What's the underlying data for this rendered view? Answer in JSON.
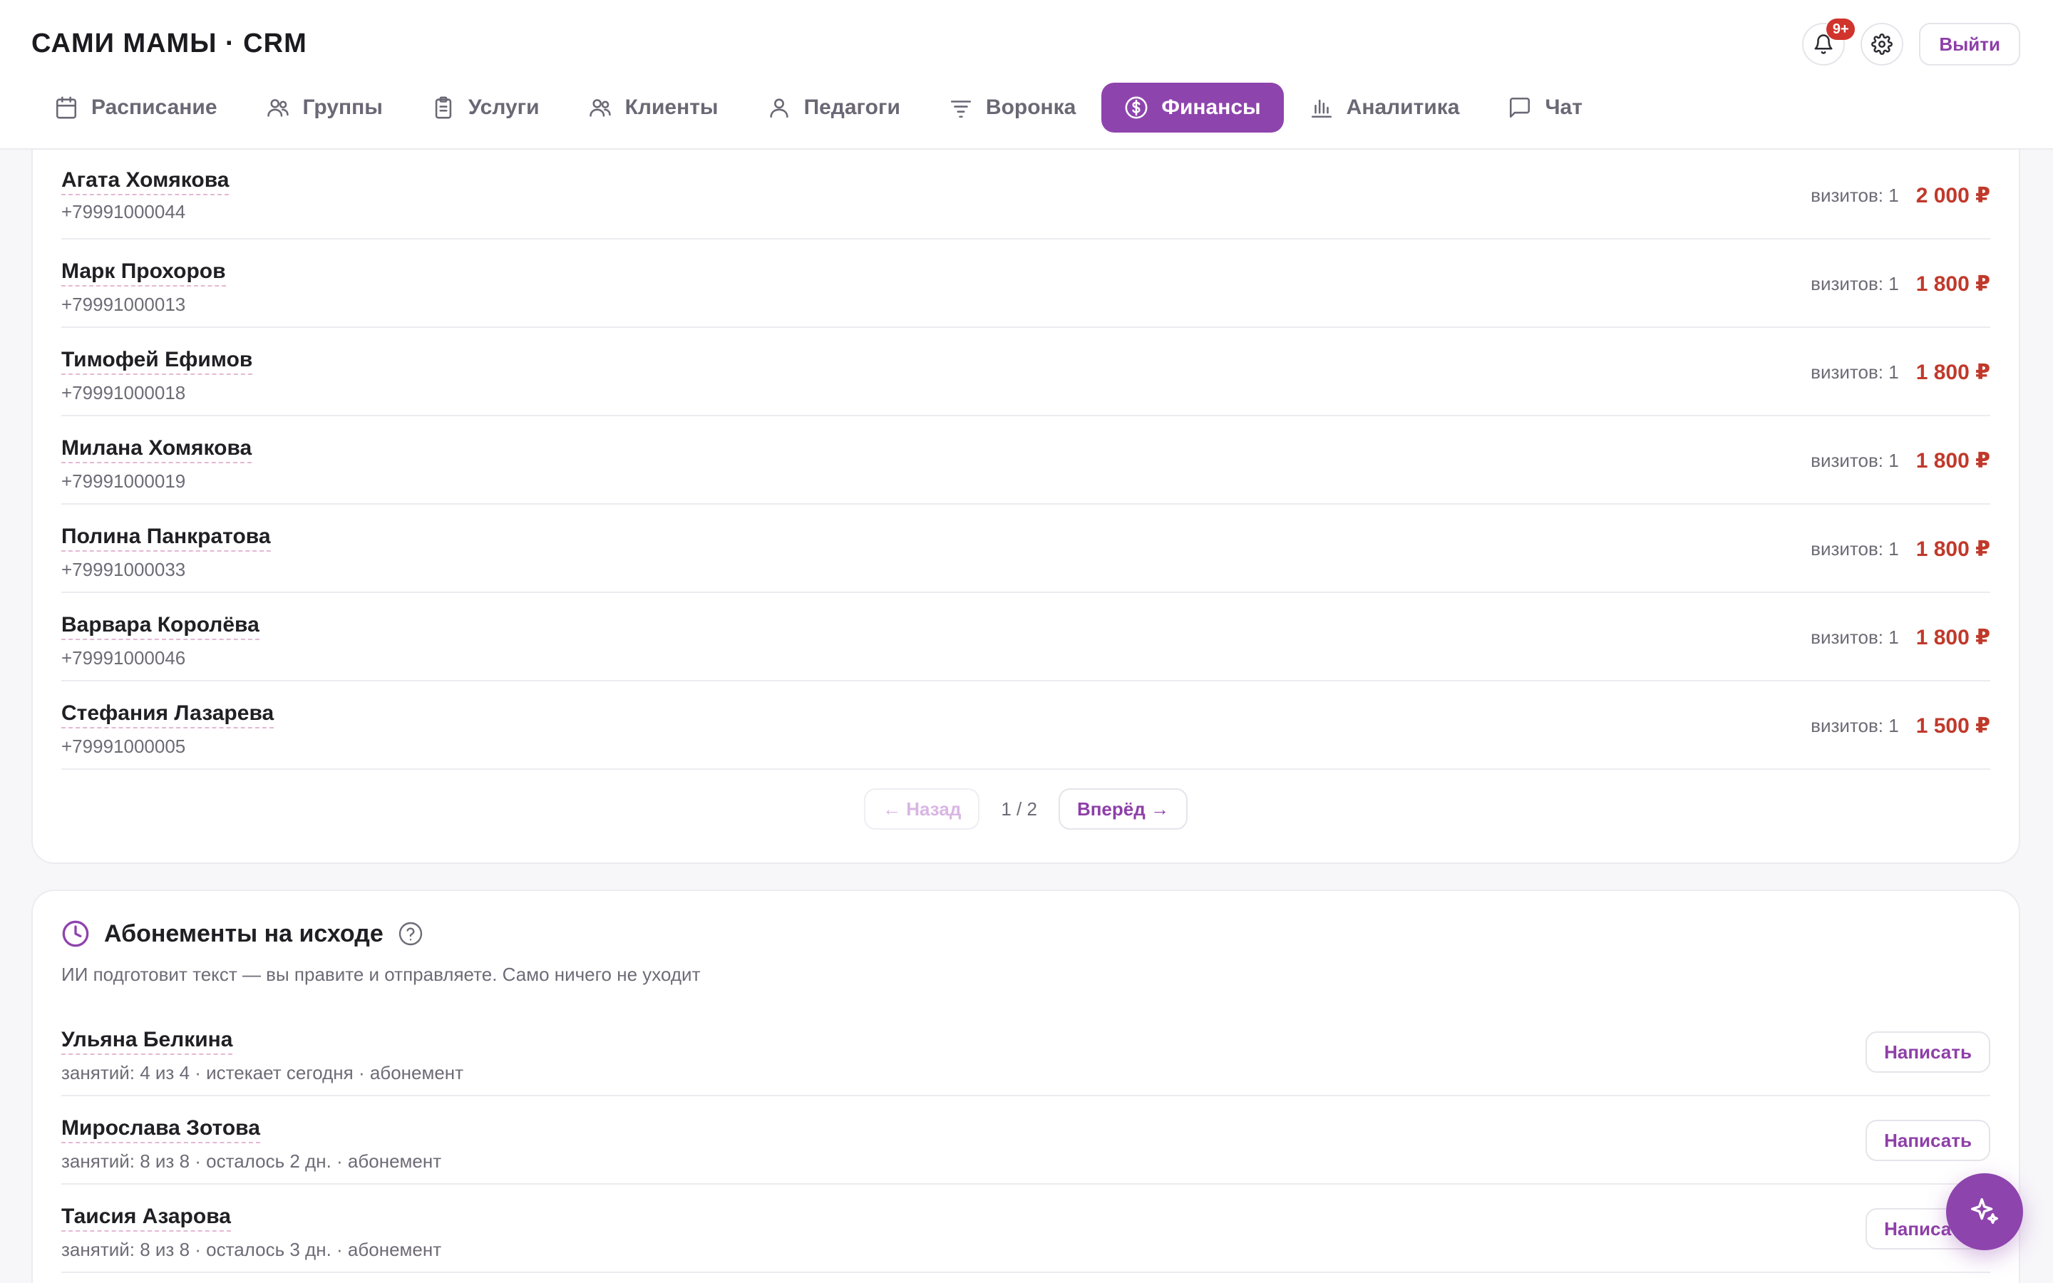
{
  "app": {
    "title": "САМИ МАМЫ · CRM"
  },
  "header": {
    "notifications_badge": "9+",
    "logout_label": "Выйти"
  },
  "nav": [
    {
      "label": "Расписание",
      "icon": "calendar-icon",
      "active": false
    },
    {
      "label": "Группы",
      "icon": "users-icon",
      "active": false
    },
    {
      "label": "Услуги",
      "icon": "clipboard-icon",
      "active": false
    },
    {
      "label": "Клиенты",
      "icon": "users-icon",
      "active": false
    },
    {
      "label": "Педагоги",
      "icon": "user-icon",
      "active": false
    },
    {
      "label": "Воронка",
      "icon": "funnel-icon",
      "active": false
    },
    {
      "label": "Финансы",
      "icon": "dollar-icon",
      "active": true
    },
    {
      "label": "Аналитика",
      "icon": "bar-chart-icon",
      "active": false
    },
    {
      "label": "Чат",
      "icon": "chat-icon",
      "active": false
    }
  ],
  "clients": {
    "rows": [
      {
        "name": "Агата Хомякова",
        "phone": "+79991000044",
        "visits": "визитов: 1",
        "amount": "2 000 ₽"
      },
      {
        "name": "Марк Прохоров",
        "phone": "+79991000013",
        "visits": "визитов: 1",
        "amount": "1 800 ₽"
      },
      {
        "name": "Тимофей Ефимов",
        "phone": "+79991000018",
        "visits": "визитов: 1",
        "amount": "1 800 ₽"
      },
      {
        "name": "Милана Хомякова",
        "phone": "+79991000019",
        "visits": "визитов: 1",
        "amount": "1 800 ₽"
      },
      {
        "name": "Полина Панкратова",
        "phone": "+79991000033",
        "visits": "визитов: 1",
        "amount": "1 800 ₽"
      },
      {
        "name": "Варвара Королёва",
        "phone": "+79991000046",
        "visits": "визитов: 1",
        "amount": "1 800 ₽"
      },
      {
        "name": "Стефания Лазарева",
        "phone": "+79991000005",
        "visits": "визитов: 1",
        "amount": "1 500 ₽"
      }
    ],
    "pager": {
      "prev_label": "← Назад",
      "page_text": "1 / 2",
      "next_label": "Вперёд →"
    }
  },
  "subscriptions": {
    "title": "Абонементы на исходе",
    "description": "ИИ подготовит текст — вы правите и отправляете. Само ничего не уходит",
    "write_label": "Написать",
    "rows": [
      {
        "name": "Ульяна Белкина",
        "details": "занятий: 4 из 4 · истекает сегодня · абонемент"
      },
      {
        "name": "Мирослава Зотова",
        "details": "занятий: 8 из 8 · осталось 2 дн. · абонемент"
      },
      {
        "name": "Таисия Азарова",
        "details": "занятий: 8 из 8 · осталось 3 дн. · абонемент"
      }
    ]
  },
  "colors": {
    "accent": "#8e44ad",
    "amount": "#c0392b",
    "badge": "#d0342c"
  }
}
